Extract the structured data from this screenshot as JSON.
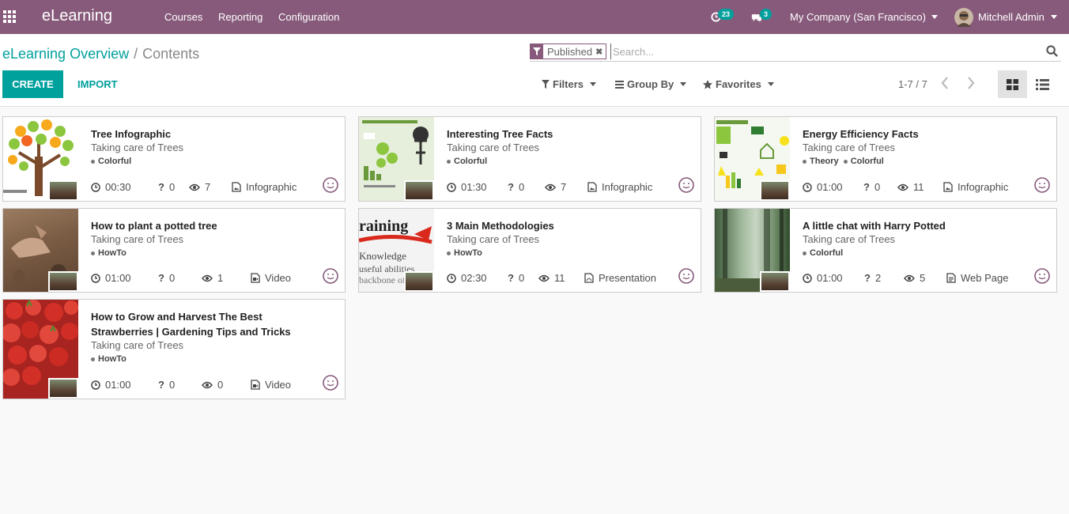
{
  "navbar": {
    "brand": "eLearning",
    "menu": [
      "Courses",
      "Reporting",
      "Configuration"
    ],
    "activity_count": "23",
    "message_count": "3",
    "company": "My Company (San Francisco)",
    "user": "Mitchell Admin",
    "color": "#875a7b"
  },
  "breadcrumb": {
    "parent": "eLearning Overview",
    "separator": "/",
    "current": "Contents"
  },
  "search": {
    "facet": "Published",
    "placeholder": "Search..."
  },
  "buttons": {
    "create": "CREATE",
    "import": "IMPORT"
  },
  "filters": {
    "filters": "Filters",
    "group_by": "Group By",
    "favorites": "Favorites"
  },
  "pager": {
    "value": "1-7 / 7"
  },
  "accent_color": "#00a09d",
  "cards": [
    {
      "title": "Tree Infographic",
      "subtitle": "Taking care of Trees",
      "tags": [
        "Colorful"
      ],
      "duration": "00:30",
      "questions": "0",
      "views": "7",
      "type": "Infographic",
      "type_icon": "image-icon"
    },
    {
      "title": "Interesting Tree Facts",
      "subtitle": "Taking care of Trees",
      "tags": [
        "Colorful"
      ],
      "duration": "01:30",
      "questions": "0",
      "views": "7",
      "type": "Infographic",
      "type_icon": "image-icon"
    },
    {
      "title": "Energy Efficiency Facts",
      "subtitle": "Taking care of Trees",
      "tags": [
        "Theory",
        "Colorful"
      ],
      "duration": "01:00",
      "questions": "0",
      "views": "11",
      "type": "Infographic",
      "type_icon": "image-icon"
    },
    {
      "title": "How to plant a potted tree",
      "subtitle": "Taking care of Trees",
      "tags": [
        "HowTo"
      ],
      "duration": "01:00",
      "questions": "0",
      "views": "1",
      "type": "Video",
      "type_icon": "video-icon"
    },
    {
      "title": "3 Main Methodologies",
      "subtitle": "Taking care of Trees",
      "tags": [
        "HowTo"
      ],
      "duration": "02:30",
      "questions": "0",
      "views": "11",
      "type": "Presentation",
      "type_icon": "pdf-icon"
    },
    {
      "title": "A little chat with Harry Potted",
      "subtitle": "Taking care of Trees",
      "tags": [
        "Colorful"
      ],
      "duration": "01:00",
      "questions": "2",
      "views": "5",
      "type": "Web Page",
      "type_icon": "webpage-icon"
    },
    {
      "title": "How to Grow and Harvest The Best Strawberries | Gardening Tips and Tricks",
      "subtitle": "Taking care of Trees",
      "tags": [
        "HowTo"
      ],
      "duration": "01:00",
      "questions": "0",
      "views": "0",
      "type": "Video",
      "type_icon": "video-icon"
    }
  ]
}
